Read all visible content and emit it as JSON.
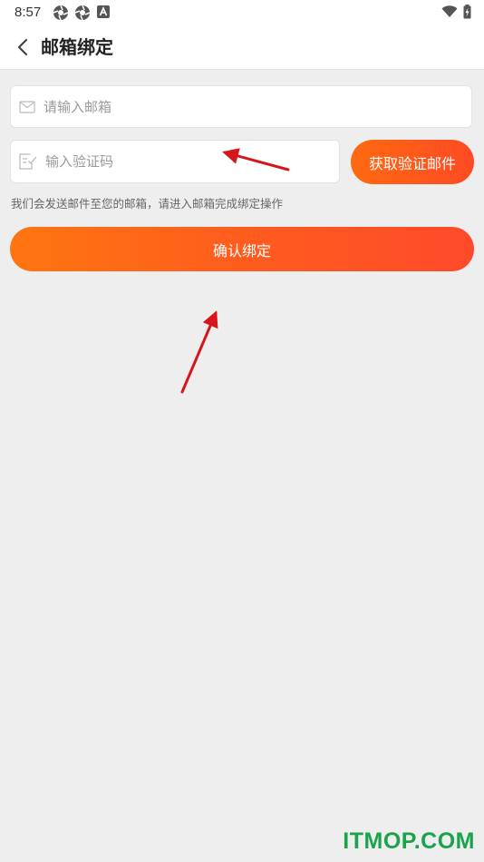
{
  "status_bar": {
    "time": "8:57"
  },
  "header": {
    "title": "邮箱绑定",
    "back_icon": "chevron-left-icon"
  },
  "email_field": {
    "icon": "envelope-icon",
    "placeholder": "请输入邮箱",
    "value": ""
  },
  "code_field": {
    "icon": "verify-code-icon",
    "placeholder": "输入验证码",
    "value": ""
  },
  "get_code_button": {
    "label": "获取验证邮件"
  },
  "hint": {
    "text": "我们会发送邮件至您的邮箱，请进入邮箱完成绑定操作"
  },
  "confirm_button": {
    "label": "确认绑定"
  },
  "watermark": {
    "text": "ITMOP.COM"
  },
  "colors": {
    "accent_start": "#ff6a10",
    "accent_end": "#ff4a25",
    "background": "#eeeeee",
    "annotation": "#d7161b",
    "watermark": "#1aa34a"
  }
}
